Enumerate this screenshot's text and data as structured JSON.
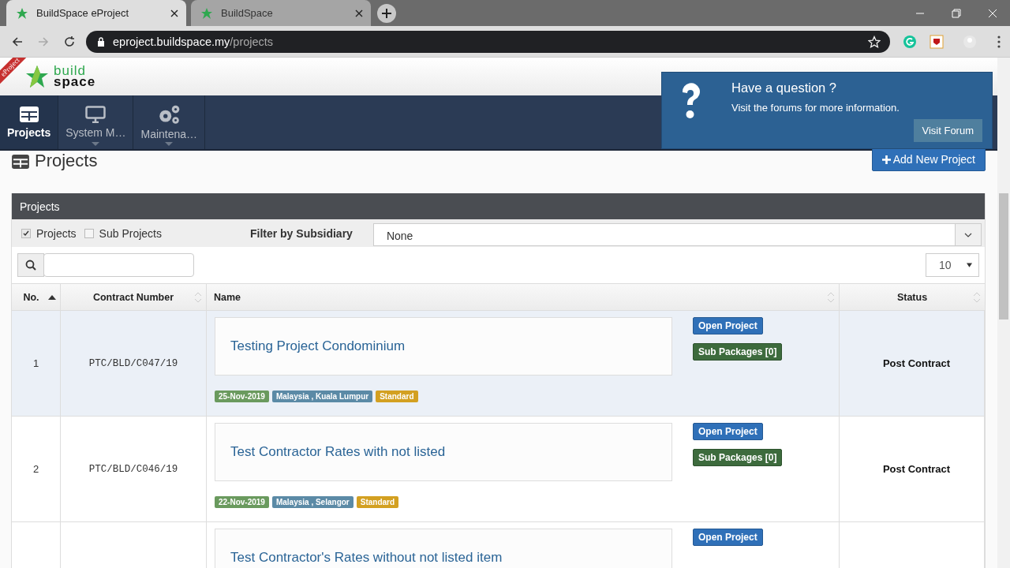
{
  "browser": {
    "tabs": [
      {
        "title": "BuildSpace eProject",
        "selected": true
      },
      {
        "title": "BuildSpace",
        "selected": false
      }
    ],
    "url": {
      "host": "eproject.buildspace.my",
      "path": "/projects"
    }
  },
  "header": {
    "ribbon": "eProject",
    "logo_top": "build",
    "logo_bottom": "space"
  },
  "nav": [
    {
      "label": "Projects",
      "kind": "grid",
      "selected": true
    },
    {
      "label": "System M…",
      "kind": "monitor",
      "selected": false
    },
    {
      "label": "Maintena…",
      "kind": "gears",
      "selected": false
    }
  ],
  "popup": {
    "title": "Have a question ?",
    "text": "Visit the forums for more information.",
    "button": "Visit Forum"
  },
  "page_title": "Projects",
  "add_button": "Add New Project",
  "panel": {
    "title": "Projects",
    "checkboxes": [
      {
        "label": "Projects",
        "checked": true
      },
      {
        "label": "Sub Projects",
        "checked": false
      }
    ],
    "filter_label": "Filter by Subsidiary",
    "filter_value": "None",
    "page_size": "10"
  },
  "table": {
    "columns": [
      {
        "label": "No.",
        "sorted": true
      },
      {
        "label": "Contract Number",
        "sorted": false
      },
      {
        "label": "Name",
        "sorted": false
      },
      {
        "label": "Status",
        "sorted": false
      }
    ],
    "rows": [
      {
        "no": "1",
        "contract": "PTC/BLD/C047/19",
        "name": "Testing Project Condominium",
        "selected": true,
        "tags": [
          {
            "text": "25-Nov-2019",
            "color": "#6a9a5e"
          },
          {
            "text": "Malaysia , Kuala Lumpur",
            "color": "#5b8aa6"
          },
          {
            "text": "Standard",
            "color": "#d3a021"
          }
        ],
        "actions": [
          {
            "label": "Open Project",
            "kind": "open"
          },
          {
            "label": "Sub Packages [0]",
            "kind": "sub"
          }
        ],
        "status": "Post Contract"
      },
      {
        "no": "2",
        "contract": "PTC/BLD/C046/19",
        "name": "Test Contractor Rates with not listed",
        "selected": false,
        "tags": [
          {
            "text": "22-Nov-2019",
            "color": "#6a9a5e"
          },
          {
            "text": "Malaysia , Selangor",
            "color": "#5b8aa6"
          },
          {
            "text": "Standard",
            "color": "#d3a021"
          }
        ],
        "actions": [
          {
            "label": "Open Project",
            "kind": "open"
          },
          {
            "label": "Sub Packages [0]",
            "kind": "sub"
          }
        ],
        "status": "Post Contract"
      },
      {
        "name": "Test Contractor's Rates without not listed item",
        "selected": false,
        "actions": [
          {
            "label": "Open Project",
            "kind": "open"
          }
        ]
      }
    ]
  }
}
